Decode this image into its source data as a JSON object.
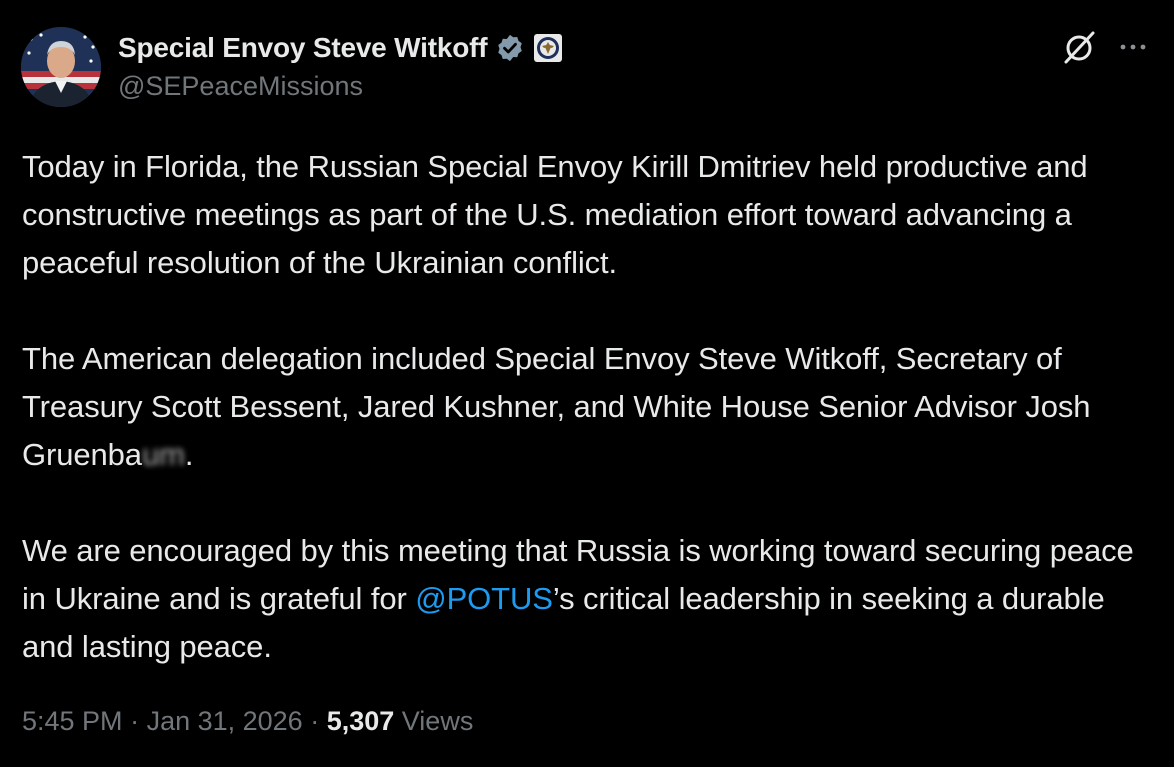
{
  "author": {
    "display_name": "Special Envoy Steve Witkoff",
    "handle": "@SEPeaceMissions",
    "verified_badge_color": "#829aab",
    "avatar_icon": "profile-photo-man-in-suit-flag-background",
    "affiliation_icon": "us-department-of-state-seal-icon"
  },
  "header_actions": {
    "grok_icon": "grok-icon",
    "more_icon": "more-options-icon"
  },
  "tweet": {
    "p1": "Today in Florida, the Russian Special Envoy Kirill Dmitriev held productive and constructive meetings as part of the U.S. mediation effort toward advancing a peaceful resolution of the Ukrainian conflict.",
    "p2_before": "The American delegation included Special Envoy Steve Witkoff, Secretary of Treasury Scott Bessent, Jared Kushner, and White House Senior Advisor Josh Gruenba",
    "p2_blurred": "um",
    "p2_after": ".",
    "p3_before": "We are encouraged by this meeting that Russia is working toward securing peace in Ukraine and is grateful for ",
    "p3_mention": "@POTUS",
    "p3_after": "’s critical leadership in seeking a durable and lasting peace."
  },
  "meta": {
    "time": "5:45 PM",
    "separator": " · ",
    "date": "Jan 31, 2026",
    "views_count": "5,307",
    "views_label": " Views"
  },
  "colors": {
    "background": "#000000",
    "text": "#e7e9ea",
    "secondary": "#71767b",
    "link": "#1d9bf0"
  }
}
